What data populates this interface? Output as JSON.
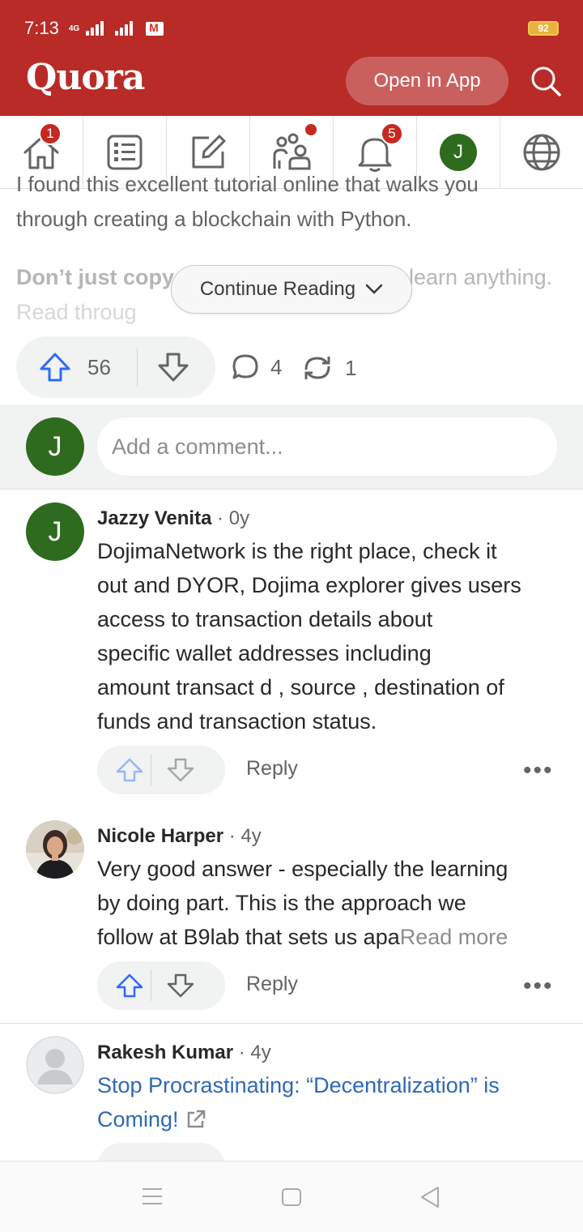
{
  "status_bar": {
    "time": "7:13",
    "network": "4G",
    "battery": "92"
  },
  "header": {
    "logo": "Quora",
    "open_app_label": "Open in App",
    "search_icon": "search-icon"
  },
  "nav": {
    "items": [
      {
        "name": "home",
        "icon": "home-icon",
        "badge": "1"
      },
      {
        "name": "following",
        "icon": "list-icon"
      },
      {
        "name": "write",
        "icon": "pencil-icon"
      },
      {
        "name": "spaces",
        "icon": "people-icon"
      },
      {
        "name": "notifications",
        "icon": "bell-icon",
        "badge": "5"
      },
      {
        "name": "profile",
        "avatar_letter": "J"
      },
      {
        "name": "language",
        "icon": "globe-icon"
      }
    ]
  },
  "answer": {
    "cut_line": "I found this excellent tutorial online that walks you",
    "line2": "through creating a blockchain with Python.",
    "fade_line1_left": "Don’t just copy",
    "fade_line1_right": "learn anything.",
    "fade_line2": "Read throug",
    "continue_label": "Continue Reading",
    "upvotes": "56",
    "comments": "4",
    "shares": "1"
  },
  "comment_box": {
    "avatar_letter": "J",
    "placeholder": "Add a comment..."
  },
  "comments": [
    {
      "avatar_letter": "J",
      "author": "Jazzy Venita",
      "time": " · 0y",
      "lines": [
        "DojimaNetwork is the right place, check it",
        "out and DYOR, Dojima explorer gives users",
        "access to transaction details about",
        "specific wallet addresses including",
        "amount transact d , source , destination of",
        "funds and transaction status."
      ],
      "reply_label": "Reply",
      "more": "•••"
    },
    {
      "author": "Nicole Harper",
      "time": " · 4y",
      "lines": [
        "Very good answer - especially the learning",
        "by doing part. This is the approach we",
        "follow at B9lab that sets us apa"
      ],
      "read_more": "Read more",
      "reply_label": "Reply",
      "more": "•••"
    },
    {
      "author": "Rakesh Kumar",
      "time": " · 4y",
      "link_line1": "Stop Procrastinating: “Decentralization” is",
      "link_line2": "Coming!"
    }
  ],
  "colors": {
    "brand": "#b92b27",
    "upvote_blue": "#2e69ff",
    "link": "#2e69b6",
    "avatar_green": "#2e6b1e"
  }
}
